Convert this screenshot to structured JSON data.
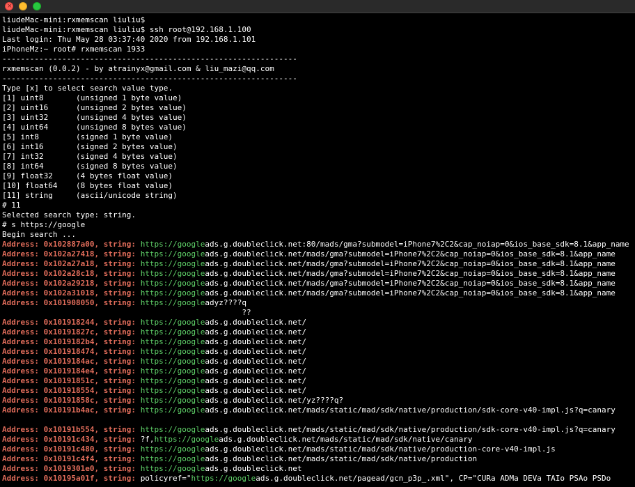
{
  "window": {
    "close_label": "×"
  },
  "lines": [
    {
      "kind": "text",
      "text": "liudeMac-mini:rxmemscan liuliu$"
    },
    {
      "kind": "text",
      "text": "liudeMac-mini:rxmemscan liuliu$ ssh root@192.168.1.100"
    },
    {
      "kind": "text",
      "text": "Last login: Thu May 28 03:37:40 2020 from 192.168.1.101"
    },
    {
      "kind": "text",
      "text": "iPhoneMz:~ root# rxmemscan 1933"
    },
    {
      "kind": "text",
      "text": "----------------------------------------------------------------"
    },
    {
      "kind": "text",
      "text": "rxmemscan (0.0.2) - by atrainyx@gmail.com & liu_mazi@qq.com"
    },
    {
      "kind": "text",
      "text": "----------------------------------------------------------------"
    },
    {
      "kind": "text",
      "text": "Type [x] to select search value type."
    },
    {
      "kind": "text",
      "text": "[1] uint8       (unsigned 1 byte value)"
    },
    {
      "kind": "text",
      "text": "[2] uint16      (unsigned 2 bytes value)"
    },
    {
      "kind": "text",
      "text": "[3] uint32      (unsigned 4 bytes value)"
    },
    {
      "kind": "text",
      "text": "[4] uint64      (unsigned 8 bytes value)"
    },
    {
      "kind": "text",
      "text": "[5] int8        (signed 1 byte value)"
    },
    {
      "kind": "text",
      "text": "[6] int16       (signed 2 bytes value)"
    },
    {
      "kind": "text",
      "text": "[7] int32       (signed 4 bytes value)"
    },
    {
      "kind": "text",
      "text": "[8] int64       (signed 8 bytes value)"
    },
    {
      "kind": "text",
      "text": "[9] float32     (4 bytes float value)"
    },
    {
      "kind": "text",
      "text": "[10] float64    (8 bytes float value)"
    },
    {
      "kind": "text",
      "text": "[11] string     (ascii/unicode string)"
    },
    {
      "kind": "text",
      "text": "# 11"
    },
    {
      "kind": "text",
      "text": "Selected search type: string."
    },
    {
      "kind": "text",
      "text": "# s https://google"
    },
    {
      "kind": "text",
      "text": "Begin search ..."
    },
    {
      "kind": "result",
      "addr": "Address: 0x102887a00, string: ",
      "pre": "",
      "match": "https://google",
      "rest": "ads.g.doubleclick.net:80/mads/gma?submodel=iPhone7%2C2&cap_noiap=0&ios_base_sdk=8.1&app_name"
    },
    {
      "kind": "result",
      "addr": "Address: 0x102a27418, string: ",
      "pre": "",
      "match": "https://google",
      "rest": "ads.g.doubleclick.net/mads/gma?submodel=iPhone7%2C2&cap_noiap=0&ios_base_sdk=8.1&app_name"
    },
    {
      "kind": "result",
      "addr": "Address: 0x102a27a18, string: ",
      "pre": "",
      "match": "https://google",
      "rest": "ads.g.doubleclick.net/mads/gma?submodel=iPhone7%2C2&cap_noiap=0&ios_base_sdk=8.1&app_name"
    },
    {
      "kind": "result",
      "addr": "Address: 0x102a28c18, string: ",
      "pre": "",
      "match": "https://google",
      "rest": "ads.g.doubleclick.net/mads/gma?submodel=iPhone7%2C2&cap_noiap=0&ios_base_sdk=8.1&app_name"
    },
    {
      "kind": "result",
      "addr": "Address: 0x102a29218, string: ",
      "pre": "",
      "match": "https://google",
      "rest": "ads.g.doubleclick.net/mads/gma?submodel=iPhone7%2C2&cap_noiap=0&ios_base_sdk=8.1&app_name"
    },
    {
      "kind": "result",
      "addr": "Address: 0x102a31018, string: ",
      "pre": "",
      "match": "https://google",
      "rest": "ads.g.doubleclick.net/mads/gma?submodel=iPhone7%2C2&cap_noiap=0&ios_base_sdk=8.1&app_name"
    },
    {
      "kind": "result",
      "addr": "Address: 0x101908050, string: ",
      "pre": "",
      "match": "https://google",
      "rest": "adyz????q"
    },
    {
      "kind": "text",
      "text": "                                                    ??"
    },
    {
      "kind": "result",
      "addr": "Address: 0x101918244, string: ",
      "pre": "",
      "match": "https://google",
      "rest": "ads.g.doubleclick.net/"
    },
    {
      "kind": "result",
      "addr": "Address: 0x10191827c, string: ",
      "pre": "",
      "match": "https://google",
      "rest": "ads.g.doubleclick.net/"
    },
    {
      "kind": "result",
      "addr": "Address: 0x1019182b4, string: ",
      "pre": "",
      "match": "https://google",
      "rest": "ads.g.doubleclick.net/"
    },
    {
      "kind": "result",
      "addr": "Address: 0x101918474, string: ",
      "pre": "",
      "match": "https://google",
      "rest": "ads.g.doubleclick.net/"
    },
    {
      "kind": "result",
      "addr": "Address: 0x1019184ac, string: ",
      "pre": "",
      "match": "https://google",
      "rest": "ads.g.doubleclick.net/"
    },
    {
      "kind": "result",
      "addr": "Address: 0x1019184e4, string: ",
      "pre": "",
      "match": "https://google",
      "rest": "ads.g.doubleclick.net/"
    },
    {
      "kind": "result",
      "addr": "Address: 0x10191851c, string: ",
      "pre": "",
      "match": "https://google",
      "rest": "ads.g.doubleclick.net/"
    },
    {
      "kind": "result",
      "addr": "Address: 0x101918554, string: ",
      "pre": "",
      "match": "https://google",
      "rest": "ads.g.doubleclick.net/"
    },
    {
      "kind": "result",
      "addr": "Address: 0x10191858c, string: ",
      "pre": "",
      "match": "https://google",
      "rest": "ads.g.doubleclick.net/yz????q?"
    },
    {
      "kind": "result",
      "addr": "Address: 0x10191b4ac, string: ",
      "pre": "",
      "match": "https://google",
      "rest": "ads.g.doubleclick.net/mads/static/mad/sdk/native/production/sdk-core-v40-impl.js?q=canary"
    },
    {
      "kind": "text",
      "text": ""
    },
    {
      "kind": "result",
      "addr": "Address: 0x10191b554, string: ",
      "pre": "",
      "match": "https://google",
      "rest": "ads.g.doubleclick.net/mads/static/mad/sdk/native/production/sdk-core-v40-impl.js?q=canary"
    },
    {
      "kind": "result",
      "addr": "Address: 0x10191c434, string: ",
      "pre": "?f,",
      "match": "https://google",
      "rest": "ads.g.doubleclick.net/mads/static/mad/sdk/native/canary"
    },
    {
      "kind": "result",
      "addr": "Address: 0x10191c480, string: ",
      "pre": "",
      "match": "https://google",
      "rest": "ads.g.doubleclick.net/mads/static/mad/sdk/native/production-core-v40-impl.js"
    },
    {
      "kind": "result",
      "addr": "Address: 0x10191c4f4, string: ",
      "pre": "",
      "match": "https://google",
      "rest": "ads.g.doubleclick.net/mads/static/mad/sdk/native/production"
    },
    {
      "kind": "result",
      "addr": "Address: 0x1019301e0, string: ",
      "pre": "",
      "match": "https://google",
      "rest": "ads.g.doubleclick.net"
    },
    {
      "kind": "result",
      "addr": "Address: 0x10195a01f, string: ",
      "pre": "policyref=\"",
      "match": "https://google",
      "rest": "ads.g.doubleclick.net/pagead/gcn_p3p_.xml\", CP=\"CURa ADMa DEVa TAIo PSAo PSDo"
    }
  ]
}
